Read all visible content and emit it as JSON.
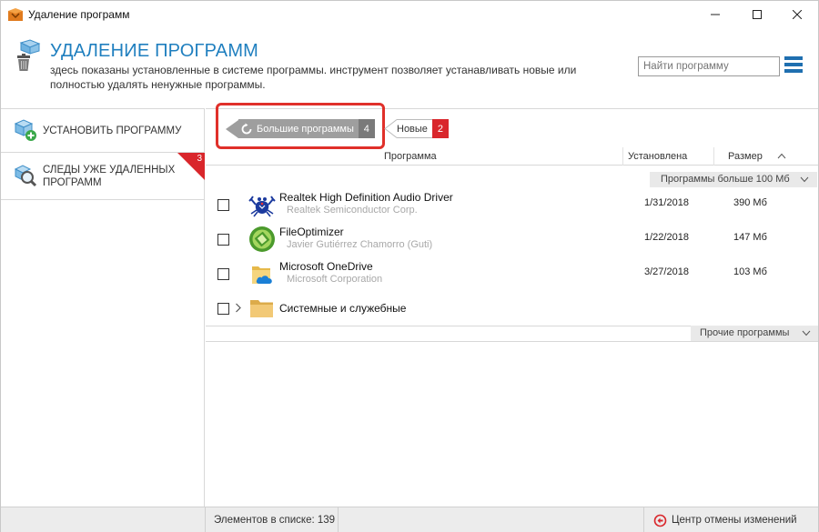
{
  "window": {
    "title": "Удаление программ"
  },
  "header": {
    "title": "УДАЛЕНИЕ ПРОГРАММ",
    "description": "здесь показаны установленные в системе программы. инструмент позволяет устанавливать новые или полностью удалять ненужные программы.",
    "search_placeholder": "Найти программу"
  },
  "sidebar": {
    "items": [
      {
        "label": "УСТАНОВИТЬ ПРОГРАММУ",
        "icon": "box-plus-icon"
      },
      {
        "label": "СЛЕДЫ УЖЕ УДАЛЕННЫХ ПРОГРАММ",
        "icon": "search-traces-icon",
        "badge": "3"
      }
    ]
  },
  "filters": {
    "big": {
      "label": "Большие программы",
      "count": "4"
    },
    "new": {
      "label": "Новые",
      "count": "2"
    }
  },
  "table": {
    "columns": {
      "program": "Программа",
      "installed": "Установлена",
      "size": "Размер"
    },
    "group_big": "Программы больше 100 Мб",
    "rows": [
      {
        "name": "Realtek High Definition Audio Driver",
        "publisher": "Realtek Semiconductor Corp.",
        "date": "1/31/2018",
        "size": "390 Мб",
        "icon": "realtek-crab-icon"
      },
      {
        "name": "FileOptimizer",
        "publisher": "Javier Gutiérrez Chamorro (Guti)",
        "date": "1/22/2018",
        "size": "147 Мб",
        "icon": "fileoptimizer-icon"
      },
      {
        "name": "Microsoft OneDrive",
        "publisher": "Microsoft Corporation",
        "date": "3/27/2018",
        "size": "103 Мб",
        "icon": "onedrive-icon"
      }
    ],
    "system_group": "Системные и служебные",
    "group_other": "Прочие программы"
  },
  "status": {
    "count": "Элементов в списке: 139",
    "undo_center": "Центр отмены изменений"
  },
  "colors": {
    "accent": "#1f7fbf",
    "badge_red": "#d9262b",
    "highlight_red": "#e0302a"
  }
}
